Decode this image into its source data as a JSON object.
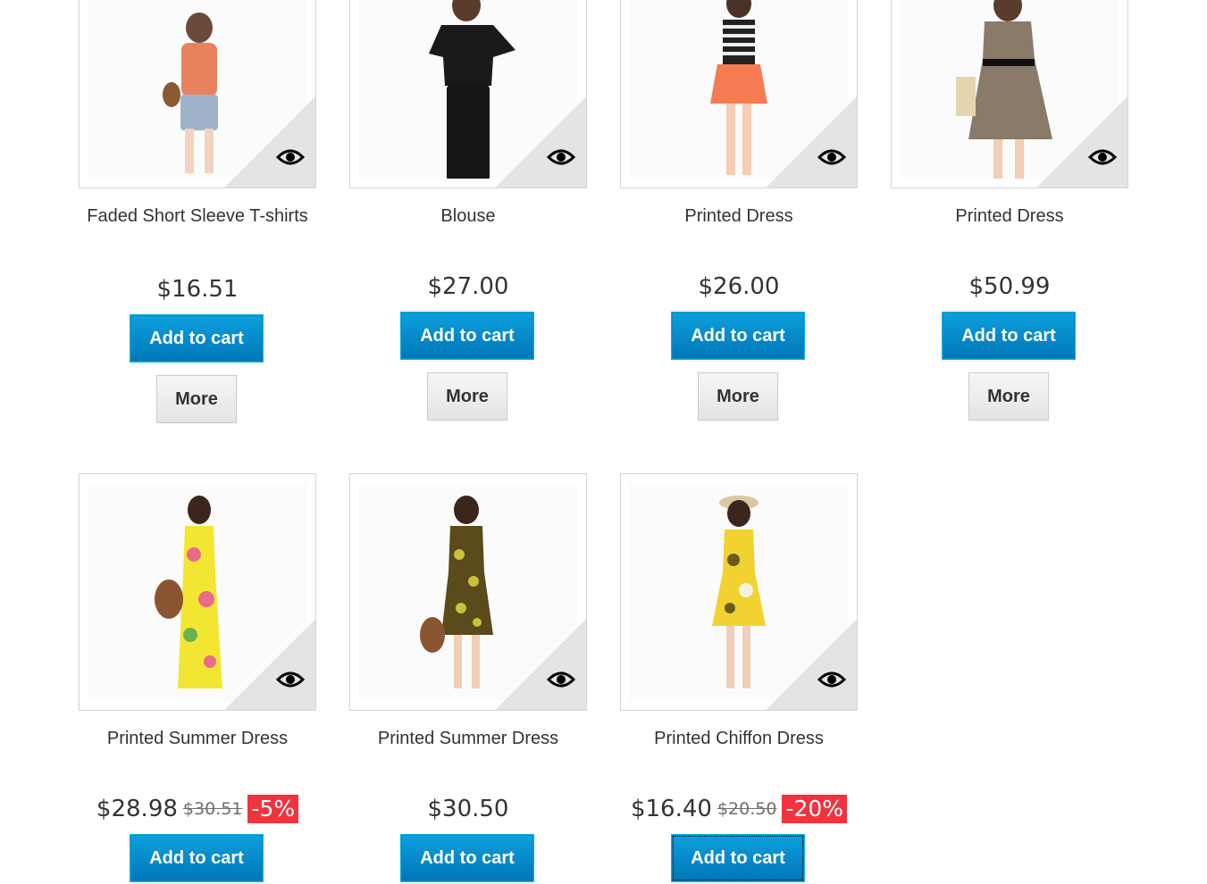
{
  "products": [
    {
      "title": "Faded Short Sleeve T-shirts",
      "price": "$16.51",
      "add_label": "Add to cart",
      "more_label": "More"
    },
    {
      "title": "Blouse",
      "price": "$27.00",
      "add_label": "Add to cart",
      "more_label": "More"
    },
    {
      "title": "Printed Dress",
      "price": "$26.00",
      "add_label": "Add to cart",
      "more_label": "More"
    },
    {
      "title": "Printed Dress",
      "price": "$50.99",
      "add_label": "Add to cart",
      "more_label": "More"
    },
    {
      "title": "Printed Summer Dress",
      "price": "$28.98",
      "old_price": "$30.51",
      "discount": "-5%",
      "add_label": "Add to cart"
    },
    {
      "title": "Printed Summer Dress",
      "price": "$30.50",
      "add_label": "Add to cart"
    },
    {
      "title": "Printed Chiffon Dress",
      "price": "$16.40",
      "old_price": "$20.50",
      "discount": "-20%",
      "add_label": "Add to cart"
    }
  ],
  "icons": {
    "quick_view": "eye-icon"
  },
  "colors": {
    "cart_button": "#0079bc",
    "discount_badge": "#f13340"
  }
}
